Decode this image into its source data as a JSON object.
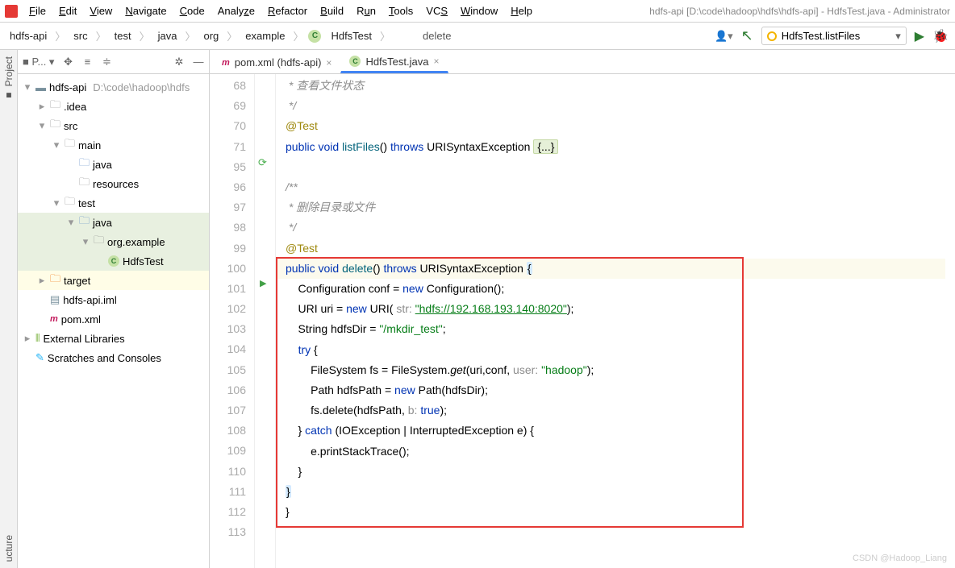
{
  "title": "hdfs-api [D:\\code\\hadoop\\hdfs\\hdfs-api] - HdfsTest.java - Administrator",
  "menu": [
    "File",
    "Edit",
    "View",
    "Navigate",
    "Code",
    "Analyze",
    "Refactor",
    "Build",
    "Run",
    "Tools",
    "VCS",
    "Window",
    "Help"
  ],
  "breadcrumbs": [
    "hdfs-api",
    "src",
    "test",
    "java",
    "org",
    "example",
    "HdfsTest"
  ],
  "nav_method": "delete",
  "run_config": "HdfsTest.listFiles",
  "toolbar": {
    "project_label": "P..."
  },
  "tabs": [
    {
      "label": "pom.xml (hdfs-api)",
      "active": false,
      "icon": "pom"
    },
    {
      "label": "HdfsTest.java",
      "active": true,
      "icon": "class"
    }
  ],
  "tree": [
    {
      "d": 0,
      "tw": "▾",
      "ic": "mod",
      "label": "hdfs-api",
      "dim": "D:\\code\\hadoop\\hdfs"
    },
    {
      "d": 1,
      "tw": "▸",
      "ic": "folder",
      "label": ".idea"
    },
    {
      "d": 1,
      "tw": "▾",
      "ic": "folder",
      "label": "src"
    },
    {
      "d": 2,
      "tw": "▾",
      "ic": "folder",
      "label": "main"
    },
    {
      "d": 3,
      "tw": "",
      "ic": "folder-blue",
      "label": "java"
    },
    {
      "d": 3,
      "tw": "",
      "ic": "folder",
      "label": "resources"
    },
    {
      "d": 2,
      "tw": "▾",
      "ic": "folder",
      "label": "test"
    },
    {
      "d": 3,
      "tw": "▾",
      "ic": "java",
      "label": "java",
      "sel": true
    },
    {
      "d": 4,
      "tw": "▾",
      "ic": "folder",
      "label": "org.example",
      "sel": true
    },
    {
      "d": 5,
      "tw": "",
      "ic": "class",
      "label": "HdfsTest",
      "sel": true
    },
    {
      "d": 1,
      "tw": "▸",
      "ic": "target",
      "label": "target",
      "hl": true
    },
    {
      "d": 1,
      "tw": "",
      "ic": "iml",
      "label": "hdfs-api.iml"
    },
    {
      "d": 1,
      "tw": "",
      "ic": "pom",
      "label": "pom.xml"
    },
    {
      "d": 0,
      "tw": "▸",
      "ic": "lib",
      "label": "External Libraries"
    },
    {
      "d": 0,
      "tw": "",
      "ic": "scratch",
      "label": "Scratches and Consoles"
    }
  ],
  "line_numbers": [
    68,
    69,
    70,
    71,
    95,
    96,
    97,
    98,
    99,
    100,
    101,
    102,
    103,
    104,
    105,
    106,
    107,
    108,
    109,
    110,
    111,
    112,
    113
  ],
  "code": {
    "c1": " * 查看文件状态",
    "c2": " */",
    "ann": "@Test",
    "l71_a": "public",
    "l71_b": "void",
    "l71_c": "listFiles",
    "l71_d": "() ",
    "l71_e": "throws",
    "l71_f": " URISyntaxException ",
    "l71_g": "{...}",
    "c96": "/**",
    "c97": " * 删除目录或文件",
    "c98": " */",
    "l100_a": "public",
    "l100_b": "void",
    "l100_c": "delete",
    "l100_d": "() ",
    "l100_e": "throws",
    "l100_f": " URISyntaxException ",
    "l100_g": "{",
    "l101": "    Configuration conf = ",
    "l101_b": "new",
    "l101_c": " Configuration();",
    "l102": "    URI uri = ",
    "l102_b": "new",
    "l102_c": " URI( ",
    "l102_p": "str:",
    "l102_s": "\"hdfs://192.168.193.140:8020\"",
    "l102_e": ");",
    "l103": "    String hdfsDir = ",
    "l103_s": "\"/mkdir_test\"",
    "l103_e": ";",
    "l104": "    ",
    "l104_b": "try",
    "l104_c": " {",
    "l105": "        FileSystem fs = FileSystem.",
    "l105_i": "get",
    "l105_c": "(uri,conf, ",
    "l105_p": "user:",
    "l105_s": "\"hadoop\"",
    "l105_e": ");",
    "l106": "        Path hdfsPath = ",
    "l106_b": "new",
    "l106_c": " Path(hdfsDir);",
    "l107": "        fs.delete(hdfsPath, ",
    "l107_p": "b:",
    "l107_b": "true",
    "l107_e": ");",
    "l108": "    } ",
    "l108_b": "catch",
    "l108_c": " (IOException | InterruptedException e) {",
    "l109": "        e.printStackTrace();",
    "l110": "    }",
    "l111": "}",
    "l112": "}"
  },
  "sidebar_labels": {
    "project": "Project",
    "structure": "ucture"
  },
  "watermark": "CSDN @Hadoop_Liang"
}
